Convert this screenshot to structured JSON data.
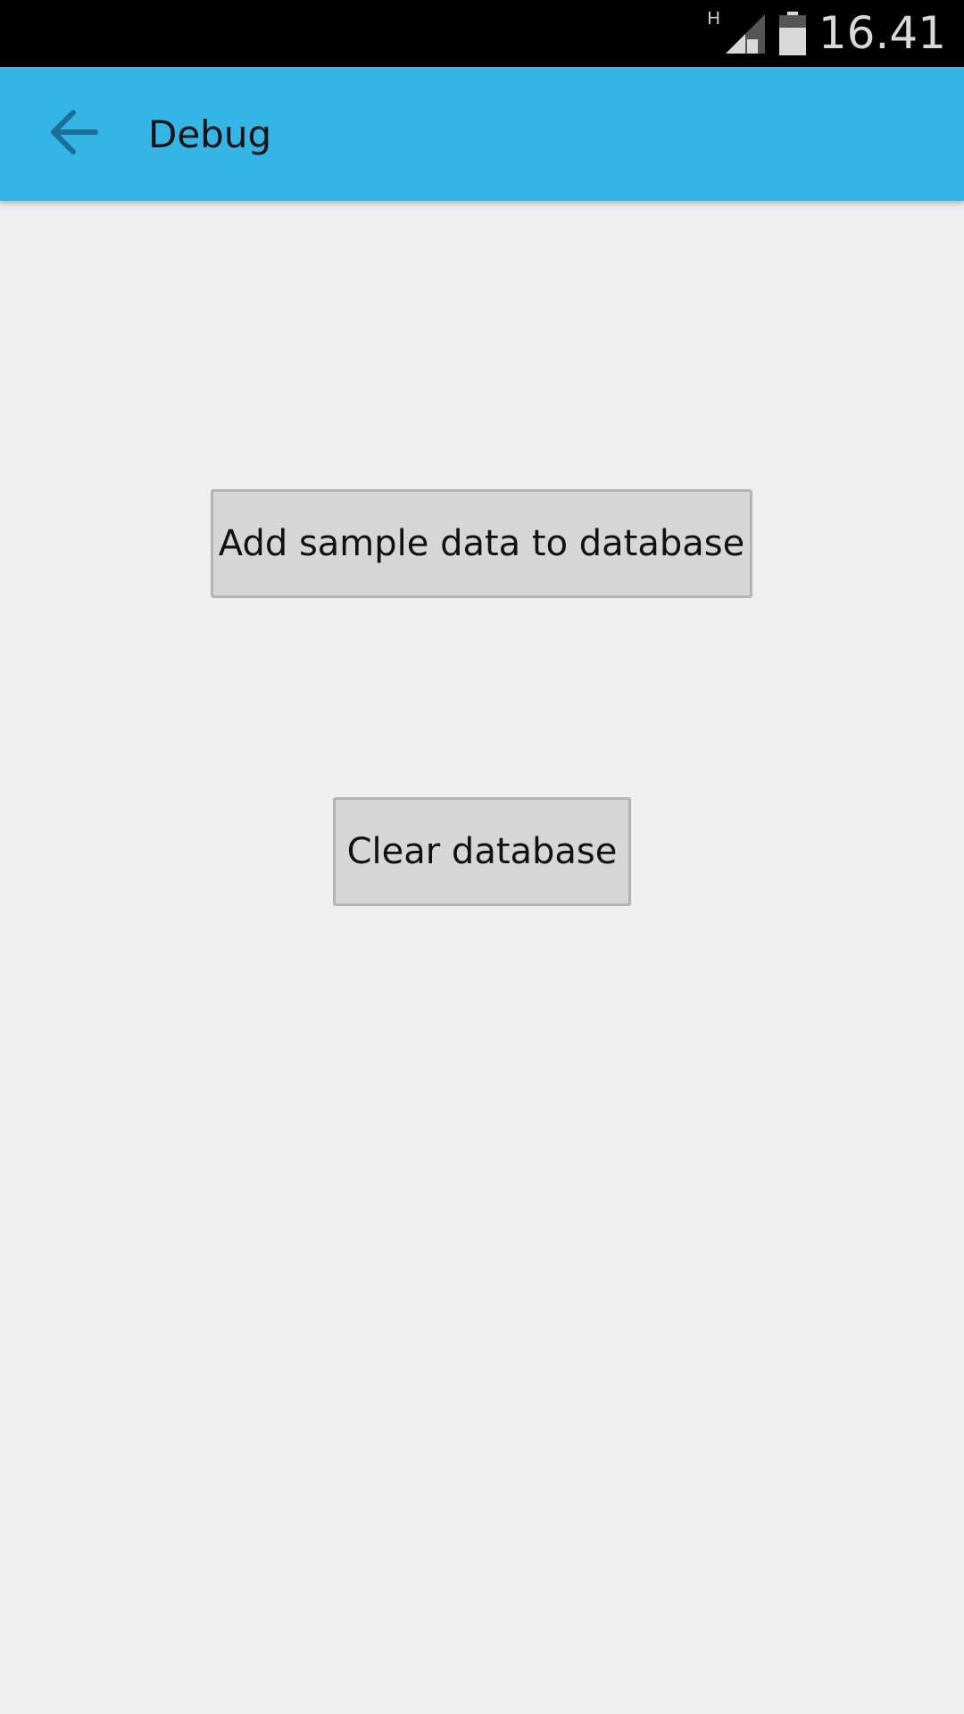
{
  "status_bar": {
    "network_type": "H",
    "time": "16.41",
    "icons": [
      "signal-icon",
      "battery-icon"
    ]
  },
  "app_bar": {
    "title": "Debug",
    "back_icon": "arrow-left-icon",
    "background_color": "#33b5e5"
  },
  "actions": {
    "add_sample_label": "Add sample data to database",
    "clear_label": "Clear database"
  }
}
